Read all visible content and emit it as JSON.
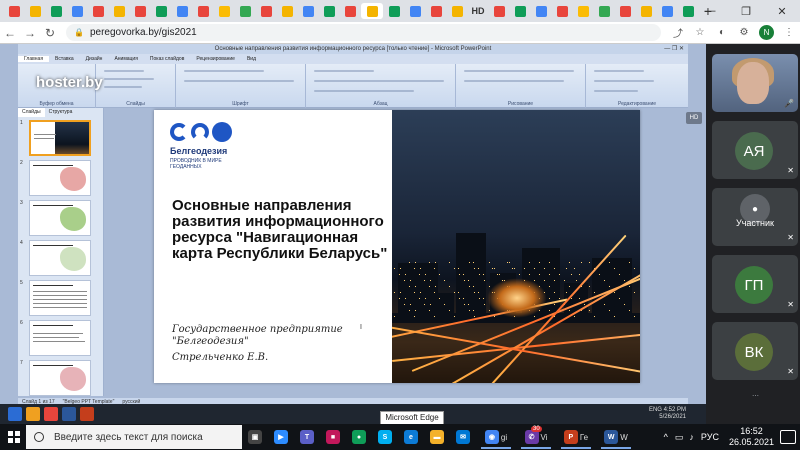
{
  "browser": {
    "url": "peregovorka.by/gis2021",
    "tab_hd": "HD",
    "profile_initial": "N",
    "tabs_colors": [
      "#e8453c",
      "#f4b400",
      "#0f9d58",
      "#4285f4",
      "#e8453c",
      "#f4b400",
      "#e8453c",
      "#0f9d58",
      "#4285f4",
      "#e8453c",
      "#fbbc05",
      "#34a853",
      "#e8453c",
      "#f4b400",
      "#4285f4",
      "#0f9d58",
      "#e8453c",
      "#f4b400",
      "#0f9d58",
      "#4285f4",
      "#e8453c",
      "#f4b400",
      "#e8453c",
      "#0f9d58",
      "#4285f4",
      "#e8453c",
      "#fbbc05",
      "#34a853",
      "#e8453c",
      "#f4b400",
      "#4285f4",
      "#0f9d58"
    ]
  },
  "powerpoint": {
    "title": "Основные направления развития информационного ресурса [только чтение] - Microsoft PowerPoint",
    "ribbon_tabs": [
      "Главная",
      "Вставка",
      "Дизайн",
      "Анимация",
      "Показ слайдов",
      "Рецензирование",
      "Вид"
    ],
    "ribbon_groups": [
      "Буфер обмена",
      "Слайды",
      "Шрифт",
      "Абзац",
      "Рисование",
      "Редактирование"
    ],
    "panel_tabs": [
      "Слайды",
      "Структура"
    ],
    "status": [
      "Слайд 1 из 17",
      "\"Belgeo PPT Template\"",
      "русский"
    ]
  },
  "watermark": "hoster.by",
  "slide": {
    "logo_name": "Белгеодезия",
    "logo_tagline": "ПРОВОДНИК В МИРЕ ГЕОДАННЫХ",
    "title": "Основные направления развития информационного ресурса \"Навигационная карта Республики Беларусь\"",
    "org": "Государственное предприятие \"Белгеодезия\"",
    "author": "Стрельченко Е.В."
  },
  "participants": [
    {
      "initials": "",
      "type": "video"
    },
    {
      "initials": "АЯ",
      "color": "#4a6b4e"
    },
    {
      "name": "Участник",
      "type": "label"
    },
    {
      "initials": "ГП",
      "color": "#3c7a3e"
    },
    {
      "initials": "ВК",
      "color": "#5b6e3a"
    }
  ],
  "hd_badge": "HD",
  "tooltip": "Microsoft Edge",
  "inner_clock": {
    "time": "4:52 PM",
    "date": "5/26/2021",
    "lang": "ENG"
  },
  "taskbar": {
    "search_placeholder": "Введите здесь текст для поиска",
    "lang": "РУС",
    "time": "16:52",
    "date": "26.05.2021",
    "running": [
      {
        "label": "gi",
        "color": "#4285f4"
      },
      {
        "label": "Vi",
        "color": "#6a3aa8",
        "badge": "30"
      },
      {
        "label": "Ге",
        "color": "#c43e1c"
      },
      {
        "label": "W",
        "color": "#2b579a"
      }
    ]
  }
}
